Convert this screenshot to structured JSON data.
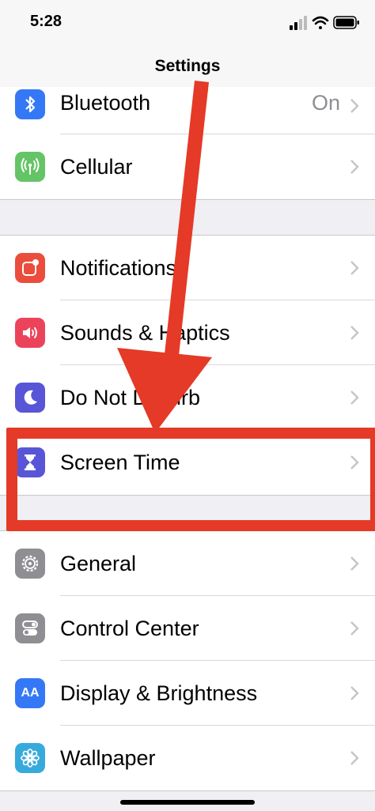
{
  "status": {
    "time": "5:28"
  },
  "nav": {
    "title": "Settings"
  },
  "rows": {
    "bluetooth": {
      "label": "Bluetooth",
      "value": "On"
    },
    "cellular": {
      "label": "Cellular"
    },
    "notifications": {
      "label": "Notifications"
    },
    "sounds": {
      "label": "Sounds & Haptics"
    },
    "dnd": {
      "label": "Do Not Disturb"
    },
    "screen_time": {
      "label": "Screen Time"
    },
    "general": {
      "label": "General"
    },
    "control_center": {
      "label": "Control Center"
    },
    "display": {
      "label": "Display & Brightness",
      "icon_text": "AA"
    },
    "wallpaper": {
      "label": "Wallpaper"
    }
  },
  "colors": {
    "annotation": "#e43a27",
    "bluetooth": "#3478f6",
    "cellular": "#65c466",
    "notifications": "#eb4d3d",
    "sounds": "#eb445a",
    "dnd": "#5856d6",
    "screen_time": "#5856d6",
    "general": "#8e8e93",
    "control_center": "#8e8e93",
    "display": "#3478f6",
    "wallpaper": "#37aadc"
  },
  "icons": {
    "bluetooth": "bluetooth-icon",
    "cellular": "antenna-icon",
    "notifications": "notifications-icon",
    "sounds": "speaker-icon",
    "dnd": "moon-icon",
    "screen_time": "hourglass-icon",
    "general": "gear-icon",
    "control_center": "toggles-icon",
    "display": "text-size-icon",
    "wallpaper": "flower-icon"
  }
}
